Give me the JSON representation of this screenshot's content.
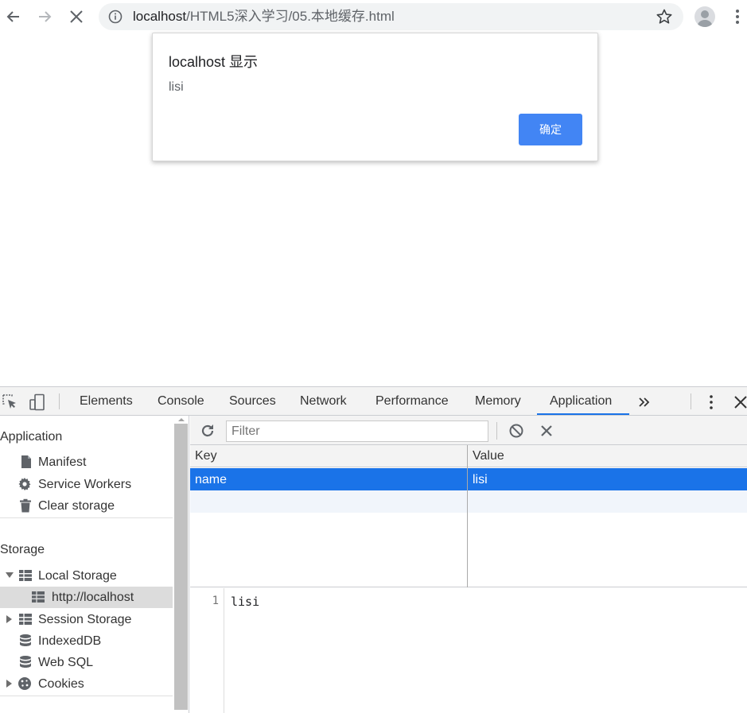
{
  "browser": {
    "url_host": "localhost",
    "url_path": "/HTML5深入学习/05.本地缓存.html",
    "icons": {
      "back": "arrow-left-icon",
      "forward": "arrow-right-icon",
      "stop": "close-icon",
      "info": "info-circle-icon",
      "bookmark": "star-outline-icon",
      "profile": "account-circle-icon",
      "menu": "kebab-menu-icon"
    }
  },
  "dialog": {
    "title": "localhost 显示",
    "message": "lisi",
    "ok_label": "确定",
    "ok_color": "#4285f4"
  },
  "devtools": {
    "tabs": [
      "Elements",
      "Console",
      "Sources",
      "Network",
      "Performance",
      "Memory",
      "Application"
    ],
    "active_tab": "Application",
    "accent": "#1a73e8",
    "sidebar": {
      "application_header": "Application",
      "application_items": [
        "Manifest",
        "Service Workers",
        "Clear storage"
      ],
      "storage_header": "Storage",
      "local_storage": "Local Storage",
      "local_storage_child": "http://localhost",
      "session_storage": "Session Storage",
      "indexeddb": "IndexedDB",
      "websql": "Web SQL",
      "cookies": "Cookies"
    },
    "storage": {
      "filter_placeholder": "Filter",
      "columns": [
        "Key",
        "Value"
      ],
      "rows": [
        {
          "key": "name",
          "value": "lisi"
        }
      ],
      "preview_line_number": "1",
      "preview_text": "lisi"
    }
  }
}
